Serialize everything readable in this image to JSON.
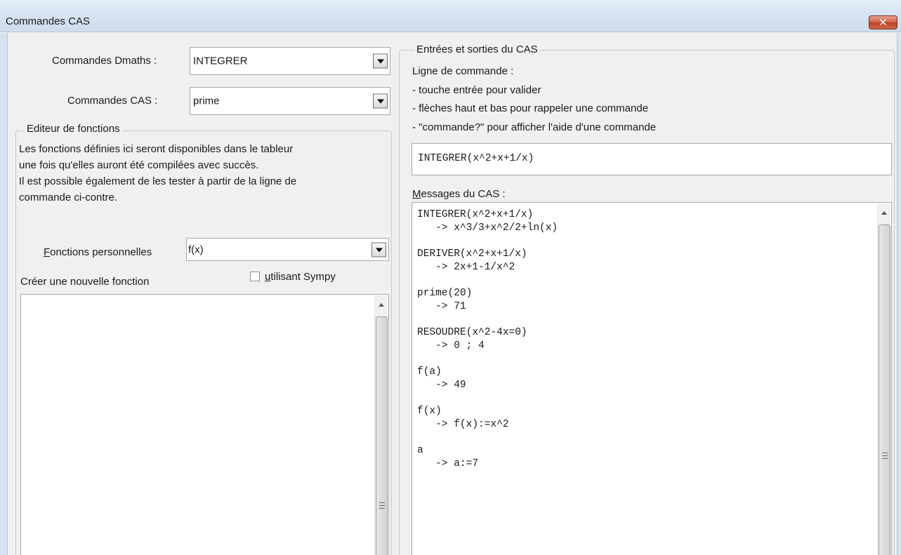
{
  "window": {
    "title": "Commandes CAS",
    "close_symbol": "✕"
  },
  "dmaths": {
    "label": "Commandes Dmaths :",
    "value": "INTEGRER"
  },
  "cas_commands": {
    "label": "Commandes CAS :",
    "value": "prime"
  },
  "function_editor": {
    "group_title": "Editeur de fonctions",
    "description": [
      "Les fonctions définies ici seront disponibles dans le tableur",
      "une fois qu'elles auront été compilées avec succès.",
      "Il est possible également de les tester à partir de la ligne de",
      "commande ci-contre."
    ],
    "personal_label_first": "F",
    "personal_label_rest": "onctions personnelles",
    "personal_value": "f(x)",
    "new_function_label": "Créer une nouvelle fonction",
    "sympy_first": "u",
    "sympy_rest": "tilisant Sympy",
    "sympy_checked": false,
    "editor_text": ""
  },
  "cas_io": {
    "group_title": "Entrées et sorties du CAS",
    "help_lines": [
      "Ligne de commande :",
      "- touche entrée pour valider",
      "- flèches haut et bas pour rappeler une commande",
      "- \"commande?\" pour afficher l'aide d'une commande"
    ],
    "command_input": "INTEGRER(x^2+x+1/x)",
    "messages_label_first": "M",
    "messages_label_rest": "essages du CAS :",
    "messages": [
      {
        "cmd": "INTEGRER(x^2+x+1/x)",
        "result": "   -> x^3/3+x^2/2+ln(x)"
      },
      {
        "cmd": "DERIVER(x^2+x+1/x)",
        "result": "   -> 2x+1-1/x^2"
      },
      {
        "cmd": "prime(20)",
        "result": "   -> 71"
      },
      {
        "cmd": "RESOUDRE(x^2-4x=0)",
        "result": "   -> 0 ; 4"
      },
      {
        "cmd": "f(a)",
        "result": "   -> 49"
      },
      {
        "cmd": "f(x)",
        "result": "   -> f(x):=x^2"
      },
      {
        "cmd": "a",
        "result": "   -> a:=7"
      }
    ]
  }
}
